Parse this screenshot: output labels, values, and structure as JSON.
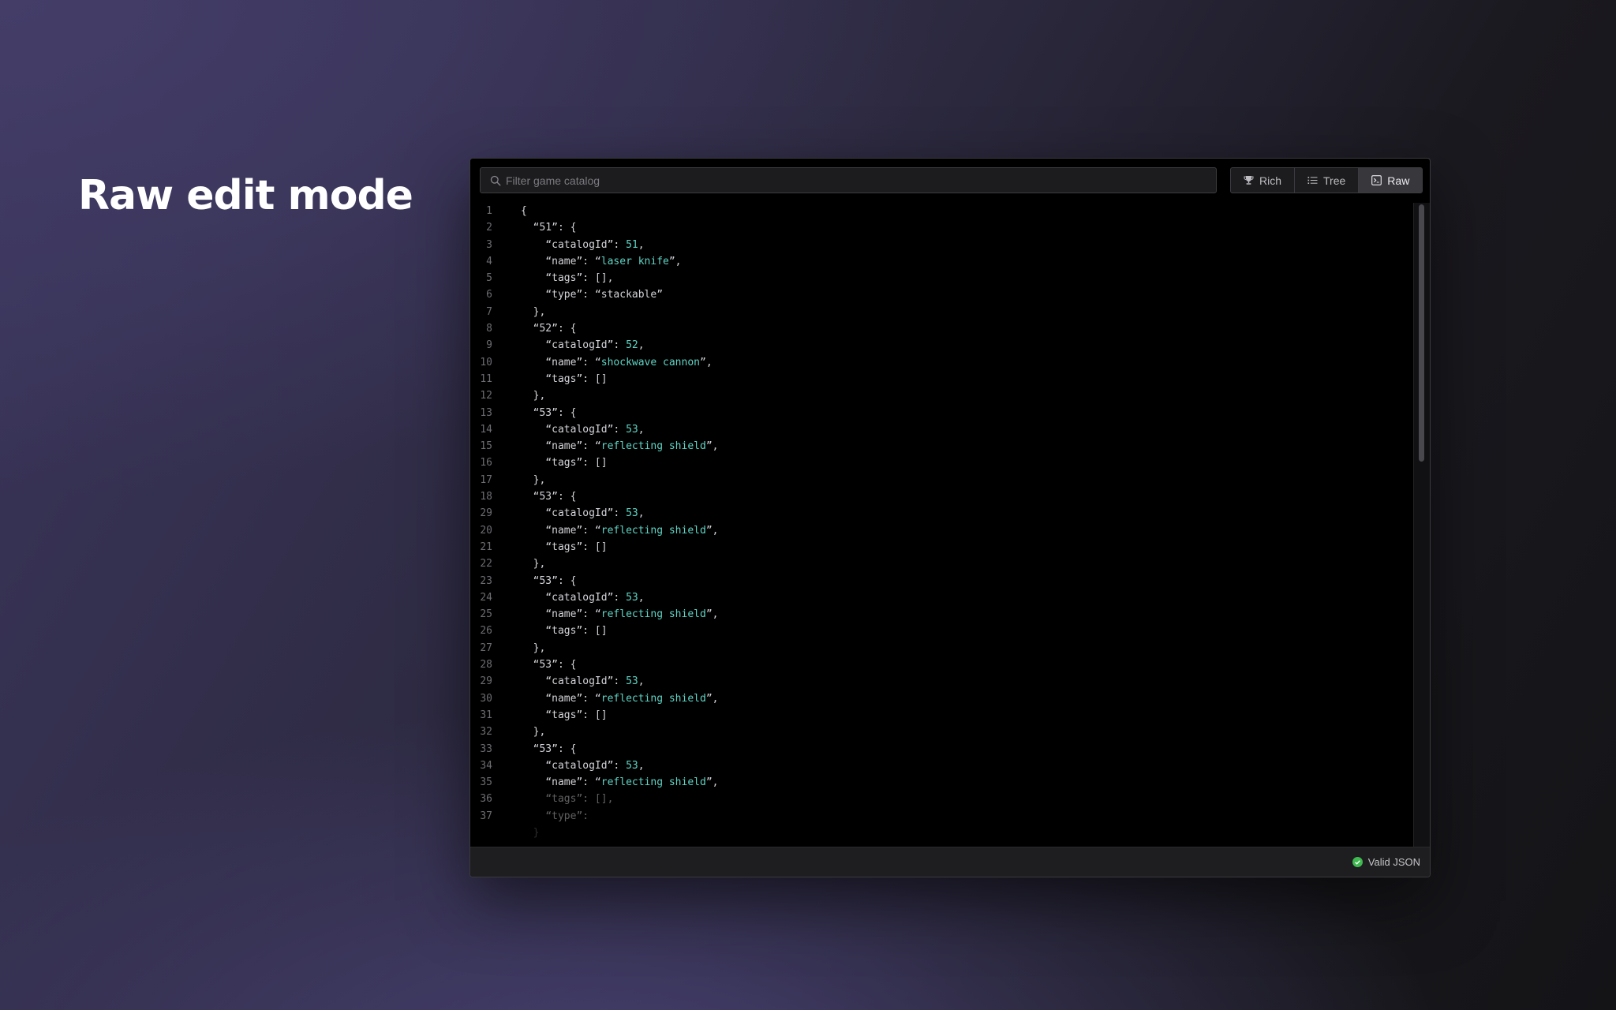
{
  "hero": {
    "title": "Raw edit mode"
  },
  "search": {
    "placeholder": "Filter game catalog",
    "value": ""
  },
  "views": [
    {
      "label": "Rich",
      "icon": "trophy-icon",
      "active": false
    },
    {
      "label": "Tree",
      "icon": "list-icon",
      "active": false
    },
    {
      "label": "Raw",
      "icon": "terminal-icon",
      "active": true
    }
  ],
  "editor": {
    "lines": [
      {
        "n": "1",
        "tokens": [
          [
            "p",
            "{"
          ]
        ]
      },
      {
        "n": "2",
        "tokens": [
          [
            "p",
            "  "
          ],
          [
            "k",
            "“51”"
          ],
          [
            "p",
            ": {"
          ]
        ]
      },
      {
        "n": "3",
        "tokens": [
          [
            "p",
            "    "
          ],
          [
            "k",
            "“catalogId”"
          ],
          [
            "p",
            ": "
          ],
          [
            "n",
            "51"
          ],
          [
            "p",
            ","
          ]
        ]
      },
      {
        "n": "4",
        "tokens": [
          [
            "p",
            "    "
          ],
          [
            "k",
            "“name”"
          ],
          [
            "p",
            ": "
          ],
          [
            "p",
            "“"
          ],
          [
            "s",
            "laser knife"
          ],
          [
            "p",
            "”,"
          ]
        ]
      },
      {
        "n": "5",
        "tokens": [
          [
            "p",
            "    "
          ],
          [
            "k",
            "“tags”"
          ],
          [
            "p",
            ": [],"
          ]
        ]
      },
      {
        "n": "6",
        "tokens": [
          [
            "p",
            "    "
          ],
          [
            "k",
            "“type”"
          ],
          [
            "p",
            ": "
          ],
          [
            "p",
            "“stackable”"
          ]
        ]
      },
      {
        "n": "7",
        "tokens": [
          [
            "p",
            "  },"
          ]
        ]
      },
      {
        "n": "8",
        "tokens": [
          [
            "p",
            "  "
          ],
          [
            "k",
            "“52”"
          ],
          [
            "p",
            ": {"
          ]
        ]
      },
      {
        "n": "9",
        "tokens": [
          [
            "p",
            "    "
          ],
          [
            "k",
            "“catalogId”"
          ],
          [
            "p",
            ": "
          ],
          [
            "n",
            "52"
          ],
          [
            "p",
            ","
          ]
        ]
      },
      {
        "n": "10",
        "tokens": [
          [
            "p",
            "    "
          ],
          [
            "k",
            "“name”"
          ],
          [
            "p",
            ": "
          ],
          [
            "p",
            "“"
          ],
          [
            "s",
            "shockwave cannon"
          ],
          [
            "p",
            "”,"
          ]
        ]
      },
      {
        "n": "11",
        "tokens": [
          [
            "p",
            "    "
          ],
          [
            "k",
            "“tags”"
          ],
          [
            "p",
            ": []"
          ]
        ]
      },
      {
        "n": "12",
        "tokens": [
          [
            "p",
            "  },"
          ]
        ]
      },
      {
        "n": "13",
        "tokens": [
          [
            "p",
            "  "
          ],
          [
            "k",
            "“53”"
          ],
          [
            "p",
            ": {"
          ]
        ]
      },
      {
        "n": "14",
        "tokens": [
          [
            "p",
            "    "
          ],
          [
            "k",
            "“catalogId”"
          ],
          [
            "p",
            ": "
          ],
          [
            "n",
            "53"
          ],
          [
            "p",
            ","
          ]
        ]
      },
      {
        "n": "15",
        "tokens": [
          [
            "p",
            "    "
          ],
          [
            "k",
            "“name”"
          ],
          [
            "p",
            ": "
          ],
          [
            "p",
            "“"
          ],
          [
            "s",
            "reflecting shield"
          ],
          [
            "p",
            "”,"
          ]
        ]
      },
      {
        "n": "16",
        "tokens": [
          [
            "p",
            "    "
          ],
          [
            "k",
            "“tags”"
          ],
          [
            "p",
            ": []"
          ]
        ]
      },
      {
        "n": "17",
        "tokens": [
          [
            "p",
            "  },"
          ]
        ]
      },
      {
        "n": "18",
        "tokens": [
          [
            "p",
            "  "
          ],
          [
            "k",
            "“53”"
          ],
          [
            "p",
            ": {"
          ]
        ]
      },
      {
        "n": "29",
        "tokens": [
          [
            "p",
            "    "
          ],
          [
            "k",
            "“catalogId”"
          ],
          [
            "p",
            ": "
          ],
          [
            "n",
            "53"
          ],
          [
            "p",
            ","
          ]
        ]
      },
      {
        "n": "20",
        "tokens": [
          [
            "p",
            "    "
          ],
          [
            "k",
            "“name”"
          ],
          [
            "p",
            ": "
          ],
          [
            "p",
            "“"
          ],
          [
            "s",
            "reflecting shield"
          ],
          [
            "p",
            "”,"
          ]
        ]
      },
      {
        "n": "21",
        "tokens": [
          [
            "p",
            "    "
          ],
          [
            "k",
            "“tags”"
          ],
          [
            "p",
            ": []"
          ]
        ]
      },
      {
        "n": "22",
        "tokens": [
          [
            "p",
            "  },"
          ]
        ]
      },
      {
        "n": "23",
        "tokens": [
          [
            "p",
            "  "
          ],
          [
            "k",
            "“53”"
          ],
          [
            "p",
            ": {"
          ]
        ]
      },
      {
        "n": "24",
        "tokens": [
          [
            "p",
            "    "
          ],
          [
            "k",
            "“catalogId”"
          ],
          [
            "p",
            ": "
          ],
          [
            "n",
            "53"
          ],
          [
            "p",
            ","
          ]
        ]
      },
      {
        "n": "25",
        "tokens": [
          [
            "p",
            "    "
          ],
          [
            "k",
            "“name”"
          ],
          [
            "p",
            ": "
          ],
          [
            "p",
            "“"
          ],
          [
            "s",
            "reflecting shield"
          ],
          [
            "p",
            "”,"
          ]
        ]
      },
      {
        "n": "26",
        "tokens": [
          [
            "p",
            "    "
          ],
          [
            "k",
            "“tags”"
          ],
          [
            "p",
            ": []"
          ]
        ]
      },
      {
        "n": "27",
        "tokens": [
          [
            "p",
            "  },"
          ]
        ]
      },
      {
        "n": "28",
        "tokens": [
          [
            "p",
            "  "
          ],
          [
            "k",
            "“53”"
          ],
          [
            "p",
            ": {"
          ]
        ]
      },
      {
        "n": "29",
        "tokens": [
          [
            "p",
            "    "
          ],
          [
            "k",
            "“catalogId”"
          ],
          [
            "p",
            ": "
          ],
          [
            "n",
            "53"
          ],
          [
            "p",
            ","
          ]
        ]
      },
      {
        "n": "30",
        "tokens": [
          [
            "p",
            "    "
          ],
          [
            "k",
            "“name”"
          ],
          [
            "p",
            ": "
          ],
          [
            "p",
            "“"
          ],
          [
            "s",
            "reflecting shield"
          ],
          [
            "p",
            "”,"
          ]
        ]
      },
      {
        "n": "31",
        "tokens": [
          [
            "p",
            "    "
          ],
          [
            "k",
            "“tags”"
          ],
          [
            "p",
            ": []"
          ]
        ]
      },
      {
        "n": "32",
        "tokens": [
          [
            "p",
            "  },"
          ]
        ]
      },
      {
        "n": "33",
        "tokens": [
          [
            "p",
            "  "
          ],
          [
            "k",
            "“53”"
          ],
          [
            "p",
            ": {"
          ]
        ]
      },
      {
        "n": "34",
        "tokens": [
          [
            "p",
            "    "
          ],
          [
            "k",
            "“catalogId”"
          ],
          [
            "p",
            ": "
          ],
          [
            "n",
            "53"
          ],
          [
            "p",
            ","
          ]
        ]
      },
      {
        "n": "35",
        "tokens": [
          [
            "p",
            "    "
          ],
          [
            "k",
            "“name”"
          ],
          [
            "p",
            ": "
          ],
          [
            "p",
            "“"
          ],
          [
            "s",
            "reflecting shield"
          ],
          [
            "p",
            "”,"
          ]
        ]
      },
      {
        "n": "36",
        "fade": 1,
        "tokens": [
          [
            "p",
            "    "
          ],
          [
            "k",
            "“tags”"
          ],
          [
            "p",
            ": [],"
          ]
        ]
      },
      {
        "n": "37",
        "fade": 1,
        "tokens": [
          [
            "p",
            "    "
          ],
          [
            "k",
            "“type”"
          ],
          [
            "p",
            ":"
          ]
        ]
      },
      {
        "n": "",
        "fade": 2,
        "tokens": [
          [
            "p",
            "  }"
          ]
        ]
      }
    ]
  },
  "status": {
    "label": "Valid JSON",
    "color": "#3fb950"
  },
  "colors": {
    "string": "#5fd4c4",
    "number": "#5fd4c4",
    "key": "#d4d4da",
    "line_number": "#6c6c72"
  }
}
